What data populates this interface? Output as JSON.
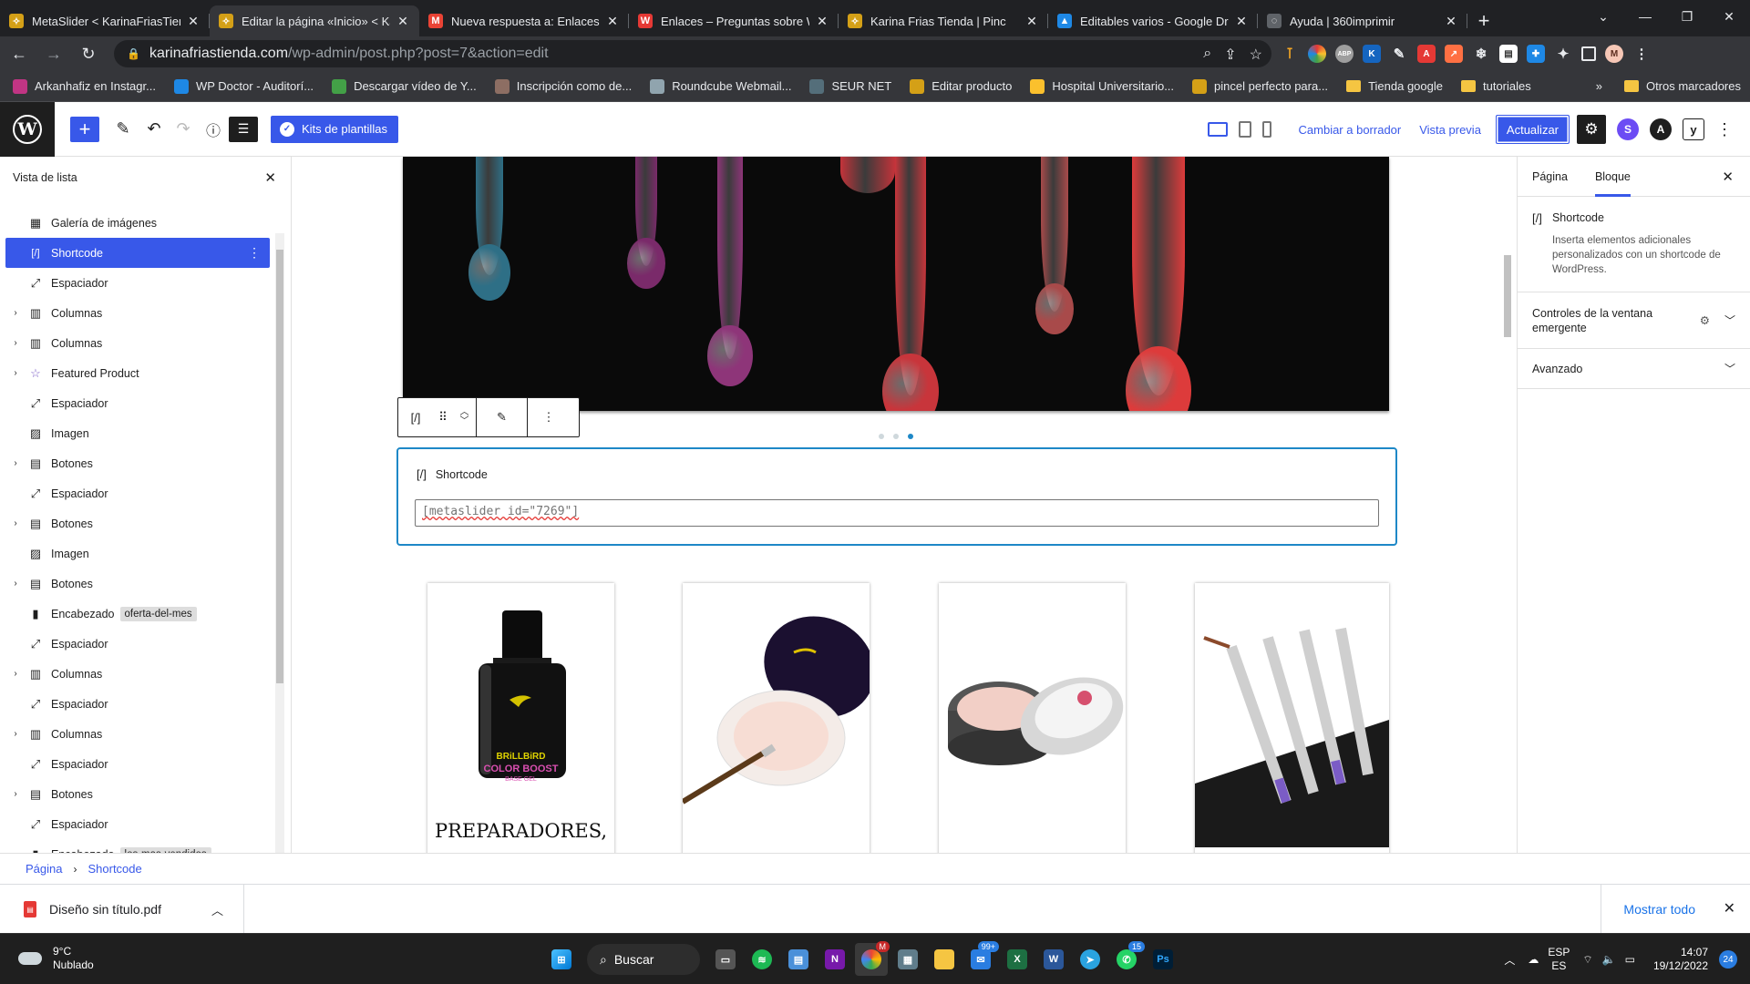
{
  "browser": {
    "tabs": [
      {
        "title": "MetaSlider < KarinaFriasTienda",
        "icon": "karina-icon",
        "color": "#d4a017"
      },
      {
        "title": "Editar la página «Inicio» < Karina",
        "icon": "karina-icon",
        "color": "#d4a017",
        "active": true
      },
      {
        "title": "Nueva respuesta a: Enlaces",
        "icon": "gmail-icon",
        "color": "#ea4335"
      },
      {
        "title": "Enlaces – Preguntas sobre W",
        "icon": "wp-icon",
        "color": "#e53935"
      },
      {
        "title": "Karina Frias Tienda | Pinc",
        "icon": "karina-icon",
        "color": "#d4a017"
      },
      {
        "title": "Editables varios - Google Dr",
        "icon": "drive-icon",
        "color": "#1e88e5"
      },
      {
        "title": "Ayuda | 360imprimir",
        "icon": "loading-icon",
        "color": "#5f6368"
      }
    ],
    "url_host": "karinafriastienda.com",
    "url_path": "/wp-admin/post.php?post=7&action=edit",
    "bookmarks": [
      {
        "label": "Arkanhafiz en Instagr...",
        "color": "#c13584"
      },
      {
        "label": "WP Doctor - Auditorí...",
        "color": "#1e88e5"
      },
      {
        "label": "Descargar vídeo de Y...",
        "color": "#43a047"
      },
      {
        "label": "Inscripción como de...",
        "color": "#8d6e63"
      },
      {
        "label": "Roundcube Webmail...",
        "color": "#90a4ae"
      },
      {
        "label": "SEUR NET",
        "color": "#546e7a"
      },
      {
        "label": "Editar producto",
        "color": "#d4a017"
      },
      {
        "label": "Hospital Universitario...",
        "color": "#fbc02d"
      },
      {
        "label": "pincel perfecto para...",
        "color": "#d4a017"
      },
      {
        "label": "Tienda google",
        "folder": true
      },
      {
        "label": "tutoriales",
        "folder": true
      }
    ],
    "bookmarks_more": "»",
    "other_bookmarks": "Otros marcadores",
    "profile_initial": "M"
  },
  "wp_header": {
    "kits_label": "Kits de plantillas",
    "switch_draft": "Cambiar a borrador",
    "preview": "Vista previa",
    "update": "Actualizar"
  },
  "list_view": {
    "title": "Vista de lista",
    "items": [
      {
        "label": "Galería de imágenes",
        "icon": "gallery-icon",
        "expand": false
      },
      {
        "label": "Shortcode",
        "icon": "shortcode-icon",
        "expand": false,
        "selected": true
      },
      {
        "label": "Espaciador",
        "icon": "spacer-icon",
        "expand": false
      },
      {
        "label": "Columnas",
        "icon": "columns-icon",
        "expand": true
      },
      {
        "label": "Columnas",
        "icon": "columns-icon",
        "expand": true
      },
      {
        "label": "Featured Product",
        "icon": "star-icon",
        "expand": true
      },
      {
        "label": "Espaciador",
        "icon": "spacer-icon",
        "expand": false
      },
      {
        "label": "Imagen",
        "icon": "image-icon",
        "expand": false
      },
      {
        "label": "Botones",
        "icon": "buttons-icon",
        "expand": true
      },
      {
        "label": "Espaciador",
        "icon": "spacer-icon",
        "expand": false
      },
      {
        "label": "Botones",
        "icon": "buttons-icon",
        "expand": true
      },
      {
        "label": "Imagen",
        "icon": "image-icon",
        "expand": false
      },
      {
        "label": "Botones",
        "icon": "buttons-icon",
        "expand": true
      },
      {
        "label": "Encabezado",
        "icon": "bookmark-icon",
        "expand": false,
        "anchor": "oferta-del-mes"
      },
      {
        "label": "Espaciador",
        "icon": "spacer-icon",
        "expand": false
      },
      {
        "label": "Columnas",
        "icon": "columns-icon",
        "expand": true
      },
      {
        "label": "Espaciador",
        "icon": "spacer-icon",
        "expand": false
      },
      {
        "label": "Columnas",
        "icon": "columns-icon",
        "expand": true
      },
      {
        "label": "Espaciador",
        "icon": "spacer-icon",
        "expand": false
      },
      {
        "label": "Botones",
        "icon": "buttons-icon",
        "expand": true
      },
      {
        "label": "Espaciador",
        "icon": "spacer-icon",
        "expand": false
      },
      {
        "label": "Encabezado",
        "icon": "bookmark-icon",
        "expand": false,
        "anchor": "los-mas-vendidos"
      }
    ]
  },
  "canvas": {
    "shortcode_label": "Shortcode",
    "shortcode_value": "[metaslider id=\"7269\"]",
    "slider_dots": 3,
    "slider_active_dot": 3,
    "product_title": "PREPARADORES,",
    "bottle_brand": "BRiLLBiRD",
    "bottle_line1": "COLOR BOOST",
    "bottle_line2": "BASE GEL"
  },
  "sidebar": {
    "tab_page": "Página",
    "tab_block": "Bloque",
    "block_title": "Shortcode",
    "block_desc": "Inserta elementos adicionales personalizados con un shortcode de WordPress.",
    "panel_popup": "Controles de la ventana emergente",
    "panel_advanced": "Avanzado"
  },
  "breadcrumb": {
    "root": "Página",
    "current": "Shortcode"
  },
  "downloads": {
    "file": "Diseño sin título.pdf",
    "show_all": "Mostrar todo"
  },
  "taskbar": {
    "temp": "9°C",
    "weather": "Nublado",
    "search": "Buscar",
    "lang1": "ESP",
    "lang2": "ES",
    "time": "14:07",
    "date": "19/12/2022",
    "notifications": "24",
    "badge_onenote": "99+",
    "badge_whatsapp": "15",
    "badge_chrome": "M"
  }
}
